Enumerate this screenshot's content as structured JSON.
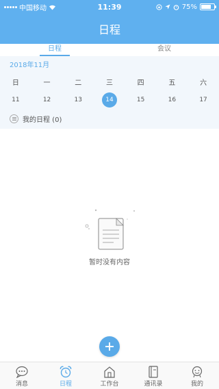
{
  "status_bar": {
    "carrier": "中国移动",
    "time": "11:39",
    "battery": "75%"
  },
  "header": {
    "title": "日程"
  },
  "tabs": [
    {
      "label": "日程",
      "active": true
    },
    {
      "label": "会议",
      "active": false
    }
  ],
  "calendar": {
    "month_label": "2018年11月",
    "weekdays": [
      "日",
      "一",
      "二",
      "三",
      "四",
      "五",
      "六"
    ],
    "dates": [
      {
        "label": "11",
        "selected": false
      },
      {
        "label": "12",
        "selected": false
      },
      {
        "label": "13",
        "selected": false
      },
      {
        "label": "14",
        "selected": true
      },
      {
        "label": "15",
        "selected": false
      },
      {
        "label": "16",
        "selected": false
      },
      {
        "label": "17",
        "selected": false
      }
    ],
    "my_schedule": "我的日程 (0)"
  },
  "empty_state": {
    "text": "暂时没有内容"
  },
  "fab": {
    "icon": "plus-icon"
  },
  "tabbar": [
    {
      "label": "消息",
      "icon": "chat-icon",
      "active": false
    },
    {
      "label": "日程",
      "icon": "alarm-clock-icon",
      "active": true
    },
    {
      "label": "工作台",
      "icon": "house-icon",
      "active": false
    },
    {
      "label": "通讯录",
      "icon": "contacts-book-icon",
      "active": false
    },
    {
      "label": "我的",
      "icon": "profile-icon",
      "active": false
    }
  ],
  "colors": {
    "primary": "#5fb0ef",
    "accent": "#5aaae8",
    "calendar_bg": "#f2f7fc"
  }
}
